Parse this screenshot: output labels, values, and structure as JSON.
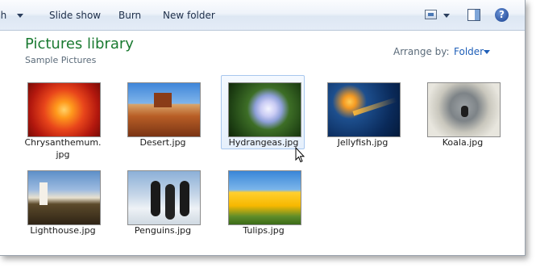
{
  "toolbar": {
    "first_item_label": "ch",
    "slideshow_label": "Slide show",
    "burn_label": "Burn",
    "new_folder_label": "New folder",
    "help_label": "?"
  },
  "library": {
    "title": "Pictures library",
    "subtitle": "Sample Pictures",
    "arrange_label": "Arrange by:",
    "arrange_value": "Folder"
  },
  "files": [
    {
      "label": "Chrysanthemum.\njpg",
      "selected": false,
      "thumb": "chrysanthemum"
    },
    {
      "label": "Desert.jpg",
      "selected": false,
      "thumb": "desert"
    },
    {
      "label": "Hydrangeas.jpg",
      "selected": true,
      "thumb": "hydrangeas"
    },
    {
      "label": "Jellyfish.jpg",
      "selected": false,
      "thumb": "jellyfish"
    },
    {
      "label": "Koala.jpg",
      "selected": false,
      "thumb": "koala"
    },
    {
      "label": "Lighthouse.jpg",
      "selected": false,
      "thumb": "lighthouse"
    },
    {
      "label": "Penguins.jpg",
      "selected": false,
      "thumb": "penguins"
    },
    {
      "label": "Tulips.jpg",
      "selected": false,
      "thumb": "tulips"
    }
  ],
  "colors": {
    "title_green": "#1a7a31",
    "link_blue": "#1f5fb8",
    "selection_border": "#a8c7ee"
  }
}
